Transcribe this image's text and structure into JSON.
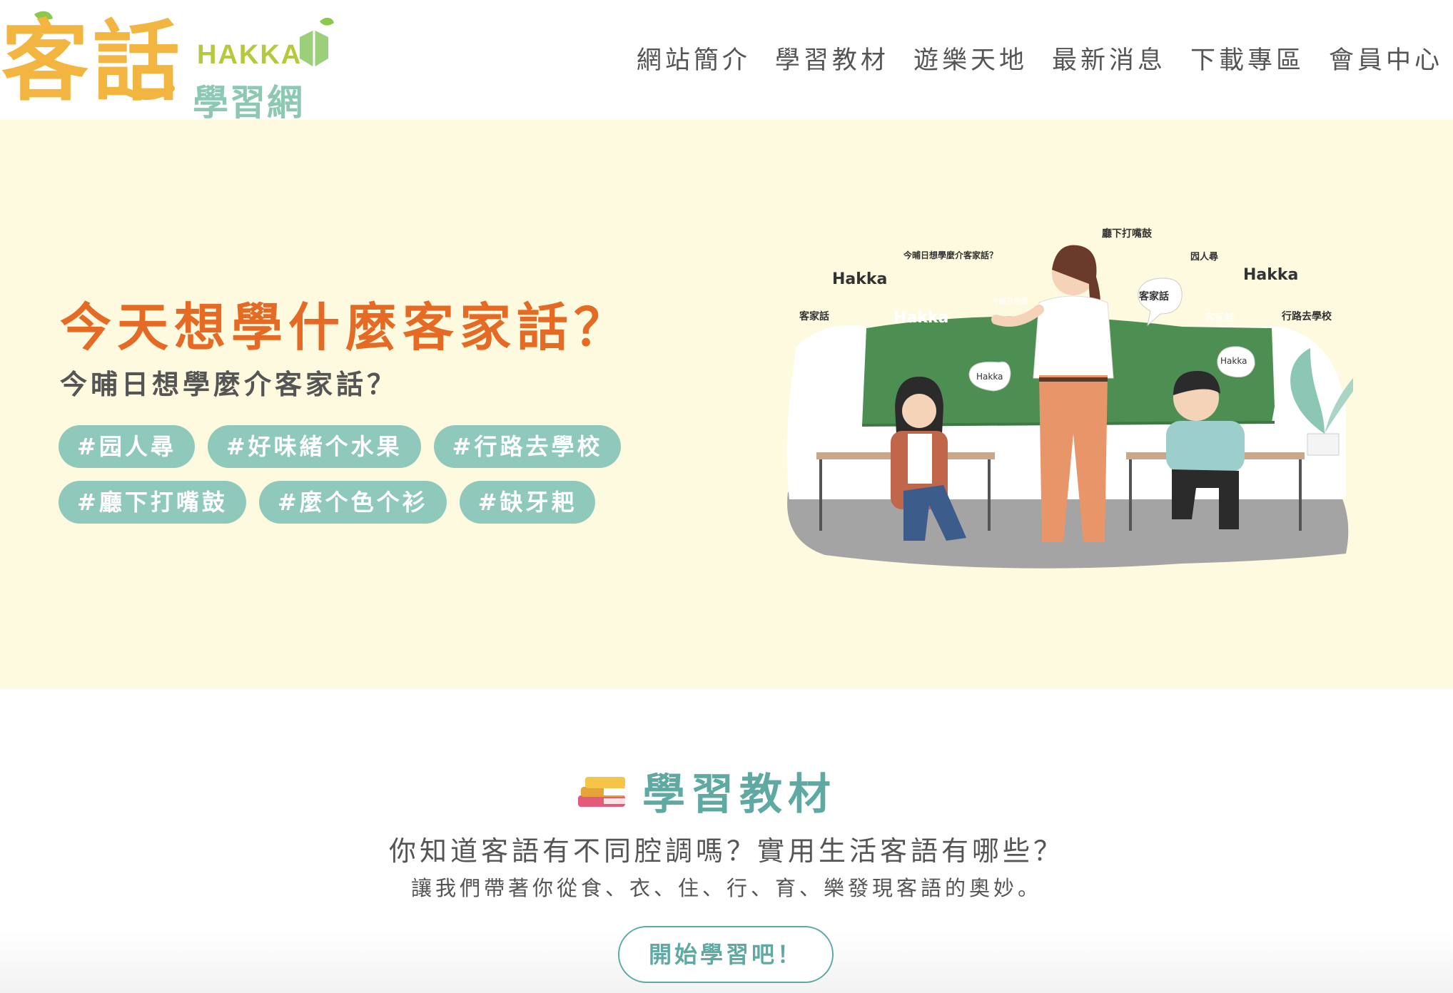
{
  "logo": {
    "char1": "客",
    "char2": "話",
    "latin": "HAKKA",
    "site_name": "學習網"
  },
  "nav": {
    "items": [
      "網站簡介",
      "學習教材",
      "遊樂天地",
      "最新消息",
      "下載專區",
      "會員中心"
    ]
  },
  "hero": {
    "title": "今天想學什麼客家話？",
    "subtitle": "今晡日想學麼介客家話？",
    "tags": [
      "#园人尋",
      "#好味緒个水果",
      "#行路去學校",
      "#廳下打嘴鼓",
      "#麼个色个衫",
      "#缺牙耙"
    ],
    "illustration": {
      "labels": [
        "廳下打嘴鼓",
        "今晡日想學麼介客家話？",
        "囥人尋",
        "Hakka",
        "Hakka",
        "客家話",
        "Hakka",
        "今晡日想學",
        "客家話",
        "客家話",
        "行路去學校",
        "Hakka",
        "Hakka"
      ]
    }
  },
  "materials": {
    "title": "學習教材",
    "line1": "你知道客語有不同腔調嗎？實用生活客語有哪些？",
    "line2": "讓我們帶著你從食、衣、住、行、育、樂發現客語的奧妙。",
    "button": "開始學習吧！"
  },
  "colors": {
    "accent_orange": "#e56a24",
    "teal": "#5fa9a3",
    "tag_bg": "#8fc9bb",
    "hero_bg": "#fefae0",
    "board_green": "#4d8f52"
  }
}
